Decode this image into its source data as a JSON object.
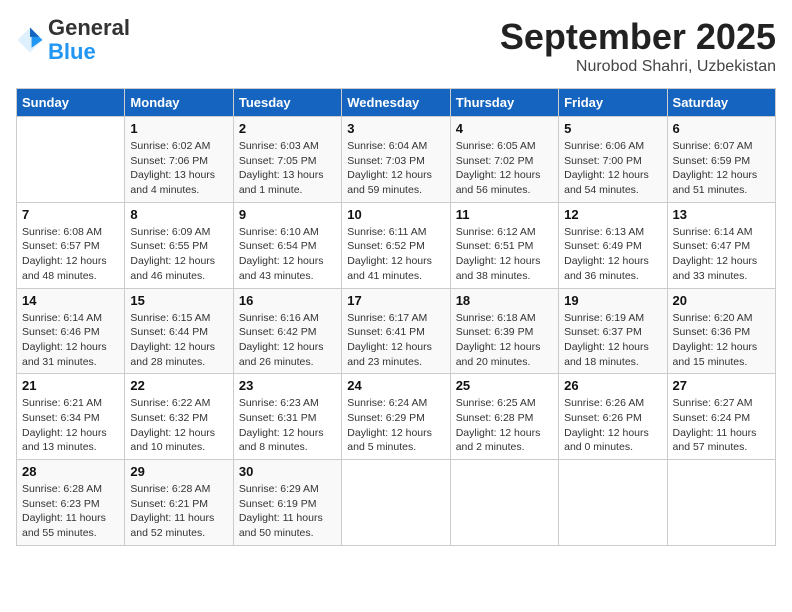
{
  "header": {
    "logo_general": "General",
    "logo_blue": "Blue",
    "month": "September 2025",
    "location": "Nurobod Shahri, Uzbekistan"
  },
  "days_of_week": [
    "Sunday",
    "Monday",
    "Tuesday",
    "Wednesday",
    "Thursday",
    "Friday",
    "Saturday"
  ],
  "weeks": [
    [
      {
        "num": "",
        "info": ""
      },
      {
        "num": "1",
        "info": "Sunrise: 6:02 AM\nSunset: 7:06 PM\nDaylight: 13 hours\nand 4 minutes."
      },
      {
        "num": "2",
        "info": "Sunrise: 6:03 AM\nSunset: 7:05 PM\nDaylight: 13 hours\nand 1 minute."
      },
      {
        "num": "3",
        "info": "Sunrise: 6:04 AM\nSunset: 7:03 PM\nDaylight: 12 hours\nand 59 minutes."
      },
      {
        "num": "4",
        "info": "Sunrise: 6:05 AM\nSunset: 7:02 PM\nDaylight: 12 hours\nand 56 minutes."
      },
      {
        "num": "5",
        "info": "Sunrise: 6:06 AM\nSunset: 7:00 PM\nDaylight: 12 hours\nand 54 minutes."
      },
      {
        "num": "6",
        "info": "Sunrise: 6:07 AM\nSunset: 6:59 PM\nDaylight: 12 hours\nand 51 minutes."
      }
    ],
    [
      {
        "num": "7",
        "info": "Sunrise: 6:08 AM\nSunset: 6:57 PM\nDaylight: 12 hours\nand 48 minutes."
      },
      {
        "num": "8",
        "info": "Sunrise: 6:09 AM\nSunset: 6:55 PM\nDaylight: 12 hours\nand 46 minutes."
      },
      {
        "num": "9",
        "info": "Sunrise: 6:10 AM\nSunset: 6:54 PM\nDaylight: 12 hours\nand 43 minutes."
      },
      {
        "num": "10",
        "info": "Sunrise: 6:11 AM\nSunset: 6:52 PM\nDaylight: 12 hours\nand 41 minutes."
      },
      {
        "num": "11",
        "info": "Sunrise: 6:12 AM\nSunset: 6:51 PM\nDaylight: 12 hours\nand 38 minutes."
      },
      {
        "num": "12",
        "info": "Sunrise: 6:13 AM\nSunset: 6:49 PM\nDaylight: 12 hours\nand 36 minutes."
      },
      {
        "num": "13",
        "info": "Sunrise: 6:14 AM\nSunset: 6:47 PM\nDaylight: 12 hours\nand 33 minutes."
      }
    ],
    [
      {
        "num": "14",
        "info": "Sunrise: 6:14 AM\nSunset: 6:46 PM\nDaylight: 12 hours\nand 31 minutes."
      },
      {
        "num": "15",
        "info": "Sunrise: 6:15 AM\nSunset: 6:44 PM\nDaylight: 12 hours\nand 28 minutes."
      },
      {
        "num": "16",
        "info": "Sunrise: 6:16 AM\nSunset: 6:42 PM\nDaylight: 12 hours\nand 26 minutes."
      },
      {
        "num": "17",
        "info": "Sunrise: 6:17 AM\nSunset: 6:41 PM\nDaylight: 12 hours\nand 23 minutes."
      },
      {
        "num": "18",
        "info": "Sunrise: 6:18 AM\nSunset: 6:39 PM\nDaylight: 12 hours\nand 20 minutes."
      },
      {
        "num": "19",
        "info": "Sunrise: 6:19 AM\nSunset: 6:37 PM\nDaylight: 12 hours\nand 18 minutes."
      },
      {
        "num": "20",
        "info": "Sunrise: 6:20 AM\nSunset: 6:36 PM\nDaylight: 12 hours\nand 15 minutes."
      }
    ],
    [
      {
        "num": "21",
        "info": "Sunrise: 6:21 AM\nSunset: 6:34 PM\nDaylight: 12 hours\nand 13 minutes."
      },
      {
        "num": "22",
        "info": "Sunrise: 6:22 AM\nSunset: 6:32 PM\nDaylight: 12 hours\nand 10 minutes."
      },
      {
        "num": "23",
        "info": "Sunrise: 6:23 AM\nSunset: 6:31 PM\nDaylight: 12 hours\nand 8 minutes."
      },
      {
        "num": "24",
        "info": "Sunrise: 6:24 AM\nSunset: 6:29 PM\nDaylight: 12 hours\nand 5 minutes."
      },
      {
        "num": "25",
        "info": "Sunrise: 6:25 AM\nSunset: 6:28 PM\nDaylight: 12 hours\nand 2 minutes."
      },
      {
        "num": "26",
        "info": "Sunrise: 6:26 AM\nSunset: 6:26 PM\nDaylight: 12 hours\nand 0 minutes."
      },
      {
        "num": "27",
        "info": "Sunrise: 6:27 AM\nSunset: 6:24 PM\nDaylight: 11 hours\nand 57 minutes."
      }
    ],
    [
      {
        "num": "28",
        "info": "Sunrise: 6:28 AM\nSunset: 6:23 PM\nDaylight: 11 hours\nand 55 minutes."
      },
      {
        "num": "29",
        "info": "Sunrise: 6:28 AM\nSunset: 6:21 PM\nDaylight: 11 hours\nand 52 minutes."
      },
      {
        "num": "30",
        "info": "Sunrise: 6:29 AM\nSunset: 6:19 PM\nDaylight: 11 hours\nand 50 minutes."
      },
      {
        "num": "",
        "info": ""
      },
      {
        "num": "",
        "info": ""
      },
      {
        "num": "",
        "info": ""
      },
      {
        "num": "",
        "info": ""
      }
    ]
  ]
}
